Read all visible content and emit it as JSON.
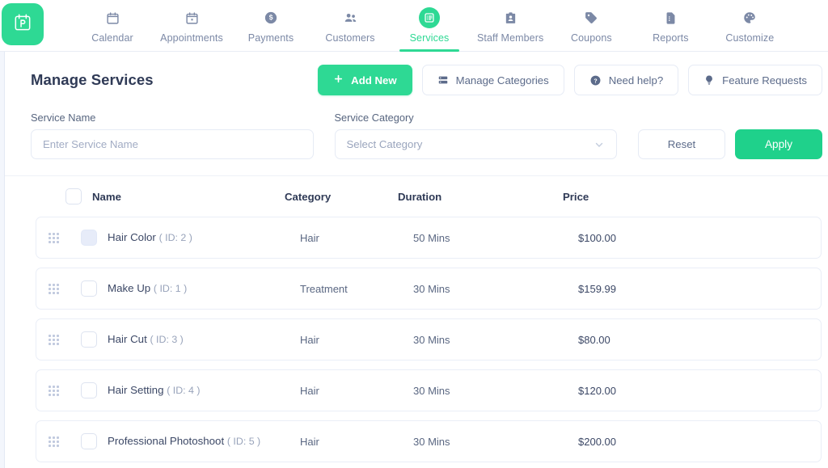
{
  "brand": {
    "logo_icon": "booking-calendar-b-icon",
    "accent_color": "#2ed994",
    "text_color": "#2f3a56"
  },
  "topnav": {
    "items": [
      {
        "label": "Calendar",
        "icon": "calendar-icon",
        "active": false
      },
      {
        "label": "Appointments",
        "icon": "calendar-dot-icon",
        "active": false
      },
      {
        "label": "Payments",
        "icon": "dollar-coin-icon",
        "active": false
      },
      {
        "label": "Customers",
        "icon": "people-icon",
        "active": false
      },
      {
        "label": "Services",
        "icon": "list-board-icon",
        "active": true
      },
      {
        "label": "Staff Members",
        "icon": "id-badge-icon",
        "active": false
      },
      {
        "label": "Coupons",
        "icon": "tag-icon",
        "active": false
      },
      {
        "label": "Reports",
        "icon": "document-icon",
        "active": false
      },
      {
        "label": "Customize",
        "icon": "palette-icon",
        "active": false
      }
    ]
  },
  "header": {
    "title": "Manage Services",
    "add_new_label": "Add New",
    "add_new_icon": "plus-icon",
    "manage_categories_label": "Manage Categories",
    "manage_categories_icon": "list-stack-icon",
    "need_help_label": "Need help?",
    "need_help_icon": "question-circle-icon",
    "feature_requests_label": "Feature Requests",
    "feature_requests_icon": "lightbulb-icon"
  },
  "filters": {
    "service_name_label": "Service Name",
    "service_name_value": "",
    "service_name_placeholder": "Enter Service Name",
    "service_category_label": "Service Category",
    "service_category_value": "Select Category",
    "category_chevron_icon": "chevron-down-icon",
    "reset_label": "Reset",
    "apply_label": "Apply"
  },
  "table": {
    "columns": {
      "name": "Name",
      "category": "Category",
      "duration": "Duration",
      "price": "Price"
    },
    "select_all_checked": false,
    "rows": [
      {
        "name": "Hair Color",
        "id": "( ID: 2 )",
        "category": "Hair",
        "duration": "50 Mins",
        "price": "$100.00",
        "checked": true
      },
      {
        "name": "Make Up",
        "id": "( ID: 1 )",
        "category": "Treatment",
        "duration": "30 Mins",
        "price": "$159.99",
        "checked": false
      },
      {
        "name": "Hair Cut",
        "id": "( ID: 3 )",
        "category": "Hair",
        "duration": "30 Mins",
        "price": "$80.00",
        "checked": false
      },
      {
        "name": "Hair Setting",
        "id": "( ID: 4 )",
        "category": "Hair",
        "duration": "30 Mins",
        "price": "$120.00",
        "checked": false
      },
      {
        "name": "Professional Photoshoot",
        "id": "( ID: 5 )",
        "category": "Hair",
        "duration": "30 Mins",
        "price": "$200.00",
        "checked": false
      }
    ]
  }
}
